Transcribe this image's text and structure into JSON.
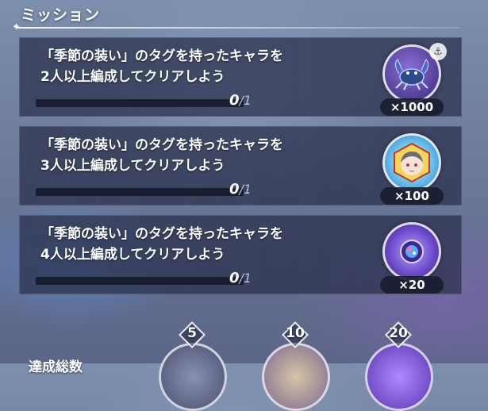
{
  "header": {
    "title": "ミッション"
  },
  "missions": [
    {
      "text": "「季節の装い」のタグを持ったキャラを\n2人以上編成してクリアしよう",
      "progress_current": "0",
      "progress_total": "1",
      "progress_fraction": 0,
      "reward_count": "×1000",
      "reward_icon": "crab-icon"
    },
    {
      "text": "「季節の装い」のタグを持ったキャラを\n3人以上編成してクリアしよう",
      "progress_current": "0",
      "progress_total": "1",
      "progress_fraction": 0,
      "reward_count": "×100",
      "reward_icon": "character-portrait-icon"
    },
    {
      "text": "「季節の装い」のタグを持ったキャラを\n4人以上編成してクリアしよう",
      "progress_current": "0",
      "progress_total": "1",
      "progress_fraction": 0,
      "reward_count": "×20",
      "reward_icon": "orb-icon"
    }
  ],
  "milestones": [
    {
      "label": "5"
    },
    {
      "label": "10"
    },
    {
      "label": "20"
    }
  ],
  "bottom": {
    "label": "達成総数"
  }
}
